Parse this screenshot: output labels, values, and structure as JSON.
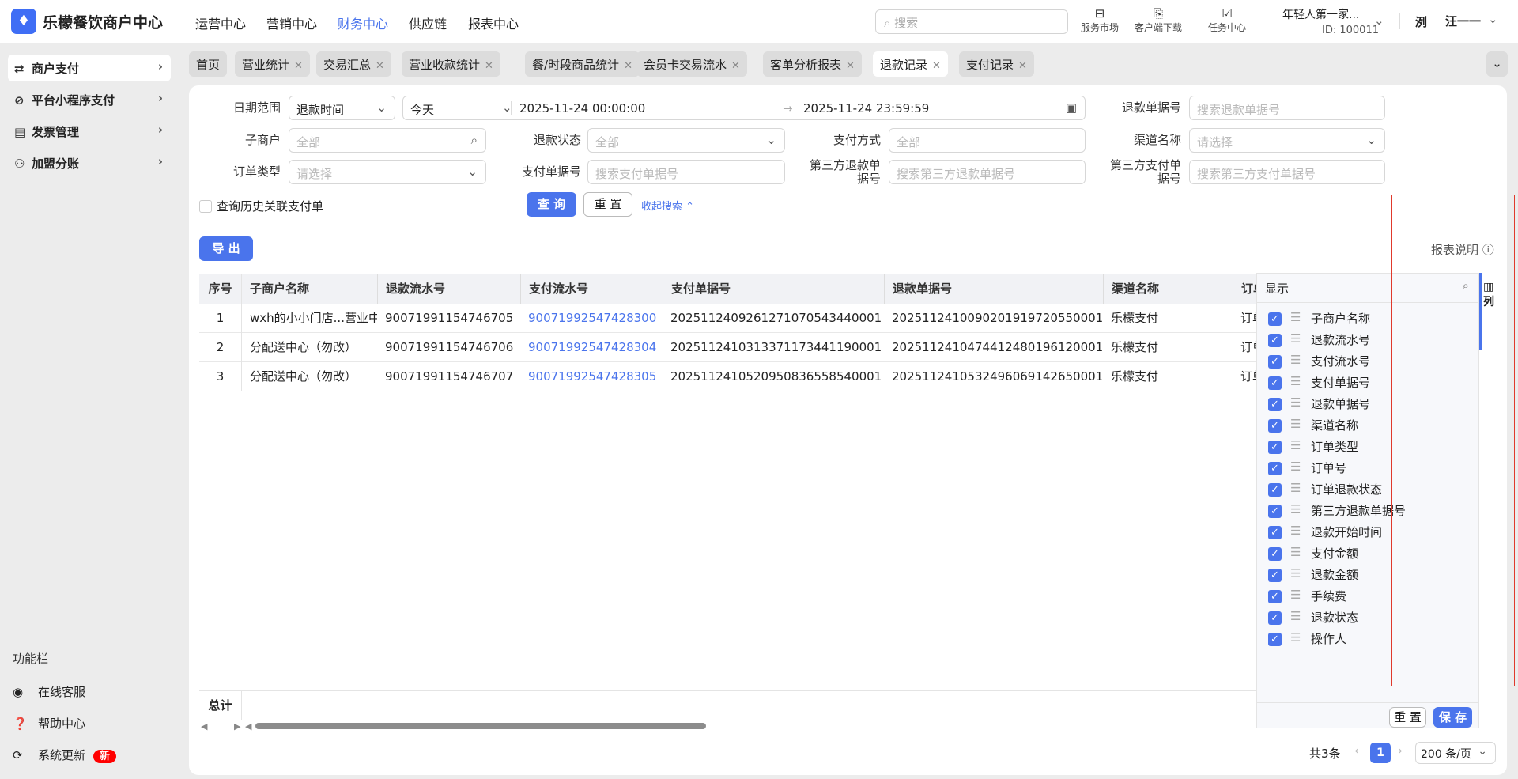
{
  "app": {
    "title": "乐檬餐饮商户中心",
    "accent": "#4a74ec"
  },
  "header": {
    "nav": [
      "运营中心",
      "营销中心",
      "财务中心",
      "供应链",
      "报表中心"
    ],
    "active_nav": "财务中心",
    "search_placeholder": "搜索",
    "tools": [
      {
        "label": "服务市场",
        "icon": "shop-bag-icon"
      },
      {
        "label": "客户端下载",
        "icon": "download-folder-icon"
      },
      {
        "label": "任务中心",
        "icon": "clipboard-check-icon"
      }
    ],
    "store": {
      "name": "年轻人第一家...",
      "id": "ID: 100011"
    },
    "user": {
      "name": "汪一一",
      "avatar_text": "洌"
    }
  },
  "sidebar": {
    "items": [
      {
        "label": "商户支付",
        "icon": "exchange-icon"
      },
      {
        "label": "平台小程序支付",
        "icon": "link-icon"
      },
      {
        "label": "发票管理",
        "icon": "invoice-icon"
      },
      {
        "label": "加盟分账",
        "icon": "user-add-icon"
      }
    ],
    "section_title": "功能栏",
    "bottom": [
      {
        "label": "在线客服",
        "icon": "headset-icon"
      },
      {
        "label": "帮助中心",
        "icon": "help-icon"
      },
      {
        "label": "系统更新",
        "icon": "refresh-icon",
        "badge": "新"
      }
    ]
  },
  "tabs": [
    {
      "label": "首页",
      "closable": false
    },
    {
      "label": "营业统计",
      "closable": true
    },
    {
      "label": "交易汇总",
      "closable": true
    },
    {
      "label": "营业收款统计",
      "closable": true
    },
    {
      "label": "餐/时段商品统计",
      "closable": true
    },
    {
      "label": "会员卡交易流水",
      "closable": true
    },
    {
      "label": "客单分析报表",
      "closable": true
    },
    {
      "label": "退款记录",
      "closable": true,
      "active": true
    },
    {
      "label": "支付记录",
      "closable": true
    }
  ],
  "filters": {
    "date_label": "日期范围",
    "date_type": "退款时间",
    "date_preset": "今天",
    "start": "2025-11-24 00:00:00",
    "end": "2025-11-24 23:59:59",
    "refund_no_label": "退款单据号",
    "refund_no_ph": "搜索退款单据号",
    "submerchant_label": "子商户",
    "submerchant_ph": "全部",
    "refund_status_label": "退款状态",
    "refund_status_ph": "全部",
    "pay_method_label": "支付方式",
    "pay_method_ph": "全部",
    "channel_label": "渠道名称",
    "channel_ph": "请选择",
    "order_type_label": "订单类型",
    "order_type_ph": "请选择",
    "pay_no_label": "支付单据号",
    "pay_no_ph": "搜索支付单据号",
    "third_refund_label": "第三方退款单据号",
    "third_refund_ph": "搜索第三方退款单据号",
    "third_pay_label": "第三方支付单据号",
    "third_pay_ph": "搜索第三方支付单据号",
    "history_label": "查询历史关联支付单",
    "query": "查 询",
    "reset": "重 置",
    "collapse": "收起搜索"
  },
  "export": "导 出",
  "report_note": "报表说明",
  "table": {
    "headers": [
      "序号",
      "子商户名称",
      "退款流水号",
      "支付流水号",
      "支付单据号",
      "退款单据号",
      "渠道名称",
      "订单"
    ],
    "rows": [
      [
        "1",
        "wxh的小小门店...营业中",
        "90071991154746705",
        "90071992547428300",
        "2025112409261271070543440001",
        "2025112410090201919720550001",
        "乐檬支付",
        "订单"
      ],
      [
        "2",
        "分配送中心（勿改）",
        "90071991154746706",
        "90071992547428304",
        "2025112410313371173441190001",
        "2025112410474412480196120001",
        "乐檬支付",
        "订单"
      ],
      [
        "3",
        "分配送中心（勿改）",
        "90071991154746707",
        "90071992547428305",
        "2025112410520950836558540001",
        "2025112410532496069142650001",
        "乐檬支付",
        "订单"
      ]
    ],
    "total_label": "总计"
  },
  "column_panel": {
    "title": "显示",
    "tab_label": "列",
    "items": [
      "子商户名称",
      "退款流水号",
      "支付流水号",
      "支付单据号",
      "退款单据号",
      "渠道名称",
      "订单类型",
      "订单号",
      "订单退款状态",
      "第三方退款单据号",
      "退款开始时间",
      "支付金额",
      "退款金额",
      "手续费",
      "退款状态",
      "操作人"
    ],
    "reset": "重 置",
    "save": "保 存"
  },
  "pagination": {
    "total": "共3条",
    "page": "1",
    "page_size": "200 条/页"
  }
}
